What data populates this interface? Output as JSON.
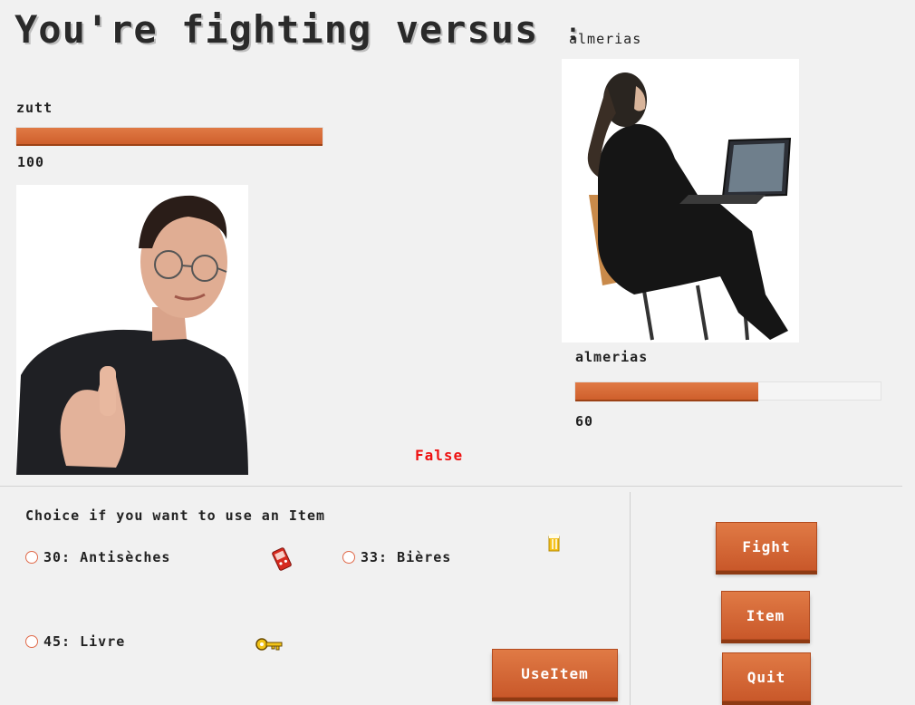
{
  "header": {
    "title": "You're fighting versus",
    "colon": ":",
    "opponent_name": "almerias"
  },
  "player": {
    "name": "zutt",
    "hp": 100,
    "hp_fraction": 1.0
  },
  "opponent": {
    "name": "almerias",
    "hp": 60,
    "hp_fraction": 0.6
  },
  "status_text": "False",
  "items": {
    "prompt": "Choice if you want to use an Item",
    "list": [
      {
        "label": "30: Antisèches",
        "icon": "red-gameboy-icon"
      },
      {
        "label": "33: Bières",
        "icon": "beer-icon"
      },
      {
        "label": "45: Livre",
        "icon": "key-icon"
      }
    ],
    "use_button": "UseItem"
  },
  "actions": {
    "fight": "Fight",
    "item": "Item",
    "quit": "Quit"
  },
  "colors": {
    "accent": "#d4622f",
    "status": "#e11111"
  }
}
